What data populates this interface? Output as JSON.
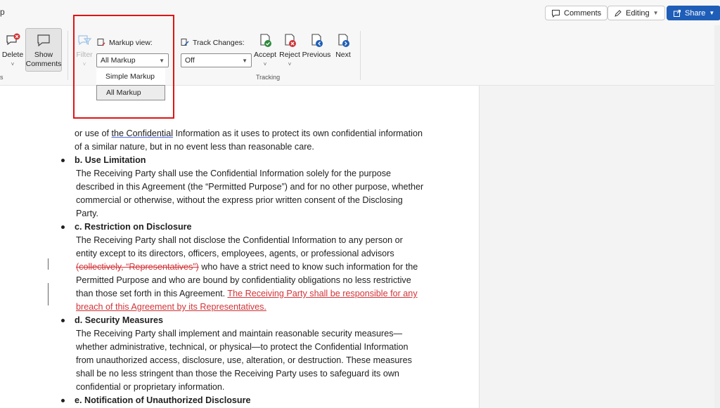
{
  "titlebar": {
    "title_fragment": "p"
  },
  "top_buttons": {
    "comments": "Comments",
    "editing": "Editing",
    "share": "Share"
  },
  "ribbon": {
    "delete_label": "Delete",
    "show_comments_label_1": "Show",
    "show_comments_label_2": "Comments",
    "filter_label": "Filter",
    "markup_view_label": "Markup view:",
    "markup_view_value": "All Markup",
    "markup_options": [
      "Simple Markup",
      "All Markup"
    ],
    "track_changes_label": "Track Changes:",
    "track_changes_value": "Off",
    "accept_label": "Accept",
    "reject_label": "Reject",
    "previous_label": "Previous",
    "next_label": "Next",
    "tracking_group_label": "Tracking",
    "group_fragment": "s"
  },
  "document": {
    "p1_a": "or use of ",
    "p1_b": "the Confidential",
    "p1_c": " Information as it uses to protect its own confidential information of a similar nature, but in no event less than reasonable care.",
    "h_b": "b. Use Limitation",
    "p_b": "The Receiving Party shall use the Confidential Information solely for the purpose described in this Agreement (the “Permitted Purpose”) and for no other purpose, whether commercial or otherwise, without the express prior written consent of the Disclosing Party.",
    "h_c": "c. Restriction on Disclosure",
    "p_c1": "The Receiving Party shall not disclose the Confidential Information to any person or entity except to its directors, officers, employees, agents, or professional advisors ",
    "p_c_del": "(collectively, “Representatives”)",
    "p_c2": " who have a strict need to know such information for the Permitted Purpose and who are bound by confidentiality obligations no less restrictive than those set forth in this Agreement. ",
    "p_c_ins": "The Receiving Party shall be responsible for any breach of this Agreement by its Representatives.",
    "h_d": "d. Security Measures",
    "p_d": "The Receiving Party shall implement and maintain reasonable security measures—whether administrative, technical, or physical—to protect the Confidential Information from unauthorized access, disclosure, use, alteration, or destruction. These measures shall be no less stringent than those the Receiving Party uses to safeguard its own confidential or proprietary information.",
    "h_e": "e. Notification of Unauthorized Disclosure"
  },
  "colors": {
    "accent": "#1f5eb8",
    "highlight_box": "#e01414",
    "revision": "#d13438"
  },
  "icons": [
    "comment-icon",
    "pencil-icon",
    "share-icon",
    "delete-comment-icon",
    "show-comments-icon",
    "filter-icon",
    "markup-view-icon",
    "track-changes-icon",
    "accept-icon",
    "reject-icon",
    "previous-icon",
    "next-icon"
  ]
}
